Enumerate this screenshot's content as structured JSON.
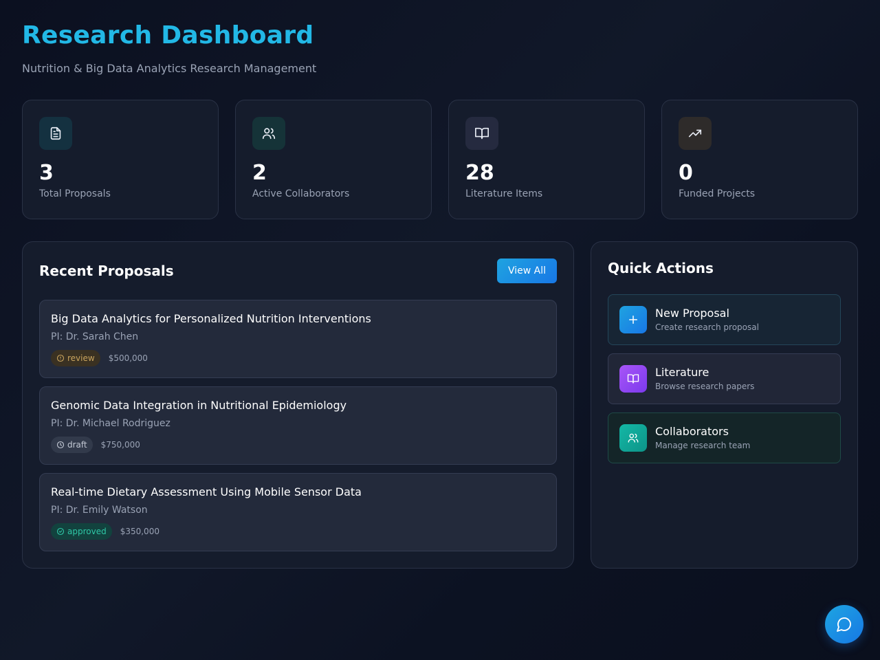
{
  "header": {
    "title": "Research Dashboard",
    "subtitle": "Nutrition & Big Data Analytics Research Management"
  },
  "stats": [
    {
      "icon": "document-icon",
      "value": "3",
      "label": "Total Proposals",
      "color": "#22b8e6"
    },
    {
      "icon": "users-icon",
      "value": "2",
      "label": "Active Collaborators",
      "color": "#2fc7a6"
    },
    {
      "icon": "book-icon",
      "value": "28",
      "label": "Literature Items",
      "color": "#a78bfa"
    },
    {
      "icon": "trending-up-icon",
      "value": "0",
      "label": "Funded Projects",
      "color": "#f5a524"
    }
  ],
  "proposals_panel": {
    "title": "Recent Proposals",
    "view_all_label": "View All",
    "items": [
      {
        "title": "Big Data Analytics for Personalized Nutrition Interventions",
        "pi": "PI: Dr. Sarah Chen",
        "status": "review",
        "amount": "$500,000"
      },
      {
        "title": "Genomic Data Integration in Nutritional Epidemiology",
        "pi": "PI: Dr. Michael Rodriguez",
        "status": "draft",
        "amount": "$750,000"
      },
      {
        "title": "Real-time Dietary Assessment Using Mobile Sensor Data",
        "pi": "PI: Dr. Emily Watson",
        "status": "approved",
        "amount": "$350,000"
      }
    ]
  },
  "quick_actions": {
    "title": "Quick Actions",
    "items": [
      {
        "icon": "plus-icon",
        "label": "New Proposal",
        "description": "Create research proposal"
      },
      {
        "icon": "book-icon",
        "label": "Literature",
        "description": "Browse research papers"
      },
      {
        "icon": "users-icon",
        "label": "Collaborators",
        "description": "Manage research team"
      }
    ]
  },
  "chat_button": {
    "icon": "chat-icon"
  },
  "colors": {
    "accent": "#22b8e6",
    "review": "#c9a45e",
    "approved": "#2fc7a6",
    "primary_button": "#1877e6"
  }
}
